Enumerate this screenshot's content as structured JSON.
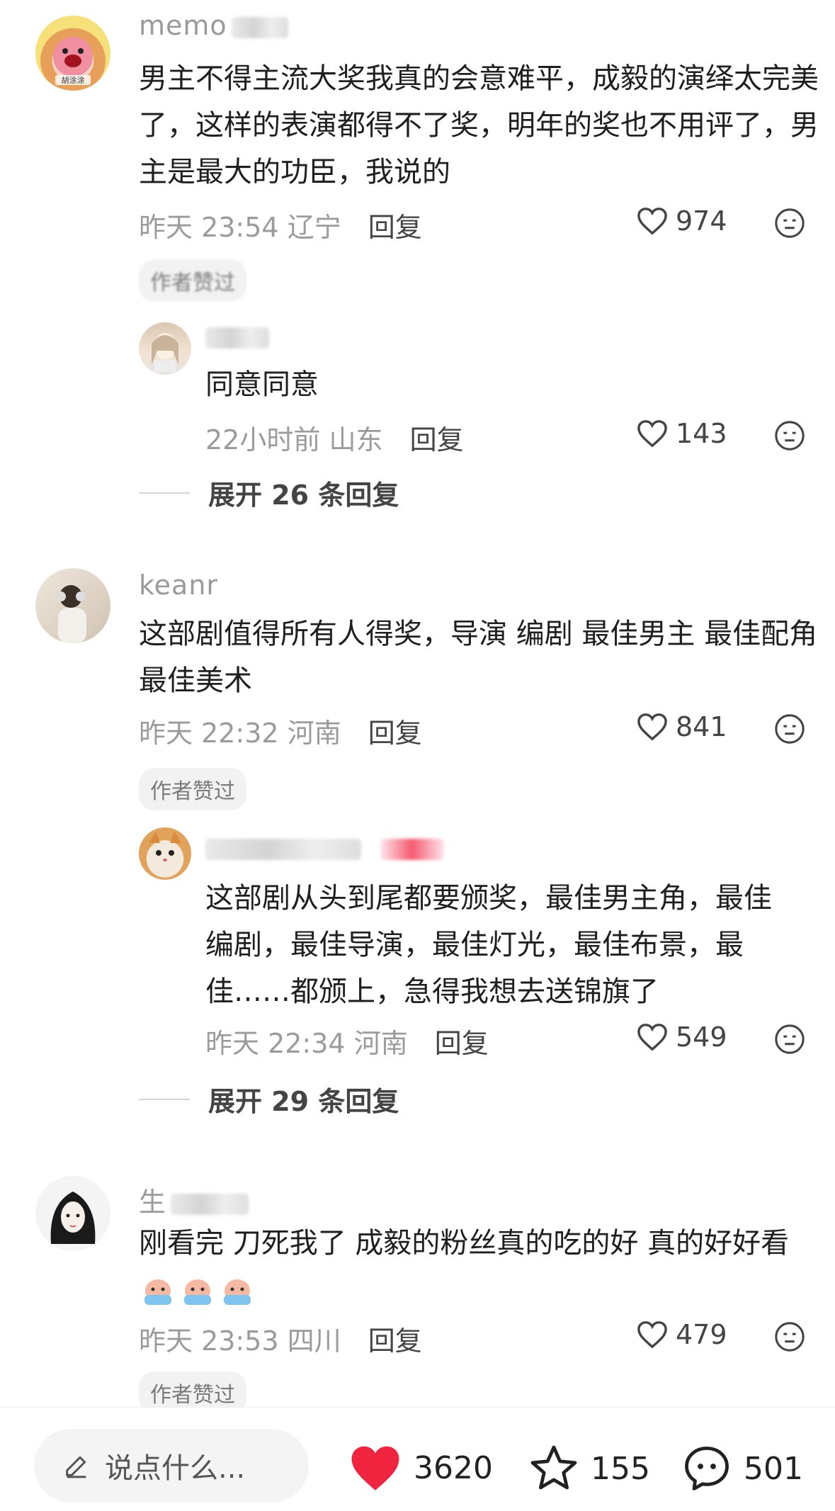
{
  "comments": [
    {
      "username_visible": "memo",
      "text": "男主不得主流大奖我真的会意难平，成毅的演绎太完美了，这样的表演都得不了奖，明年的奖也不用评了，男主是最大的功臣，我说的",
      "time": "昨天 23:54",
      "location": "辽宁",
      "reply_label": "回复",
      "likes": "974",
      "badge": "作者赞过",
      "avatar_text": "胡涂涂",
      "sub_reply": {
        "text": "同意同意",
        "time": "22小时前",
        "location": "山东",
        "reply_label": "回复",
        "likes": "143"
      },
      "expand_label": "展开 26 条回复"
    },
    {
      "username_visible": "keanr",
      "text": "这部剧值得所有人得奖，导演 编剧 最佳男主 最佳配角 最佳美术",
      "time": "昨天 22:32",
      "location": "河南",
      "reply_label": "回复",
      "likes": "841",
      "badge": "作者赞过",
      "sub_reply": {
        "text": "这部剧从头到尾都要颁奖，最佳男主角，最佳编剧，最佳导演，最佳灯光，最佳布景，最佳……都颁上，急得我想去送锦旗了",
        "time": "昨天 22:34",
        "location": "河南",
        "reply_label": "回复",
        "likes": "549"
      },
      "expand_label": "展开 29 条回复"
    },
    {
      "username_visible": "生",
      "text": "刚看完 刀死我了 成毅的粉丝真的吃的好 真的好好看",
      "time": "昨天 23:53",
      "location": "四川",
      "reply_label": "回复",
      "likes": "479",
      "badge": "作者赞过",
      "emoji_icon": "crying-face-sticker-icon"
    }
  ],
  "bottom_bar": {
    "input_placeholder": "说点什么...",
    "likes": "3620",
    "favorites": "155",
    "comments": "501",
    "like_color": "#f0243f"
  }
}
